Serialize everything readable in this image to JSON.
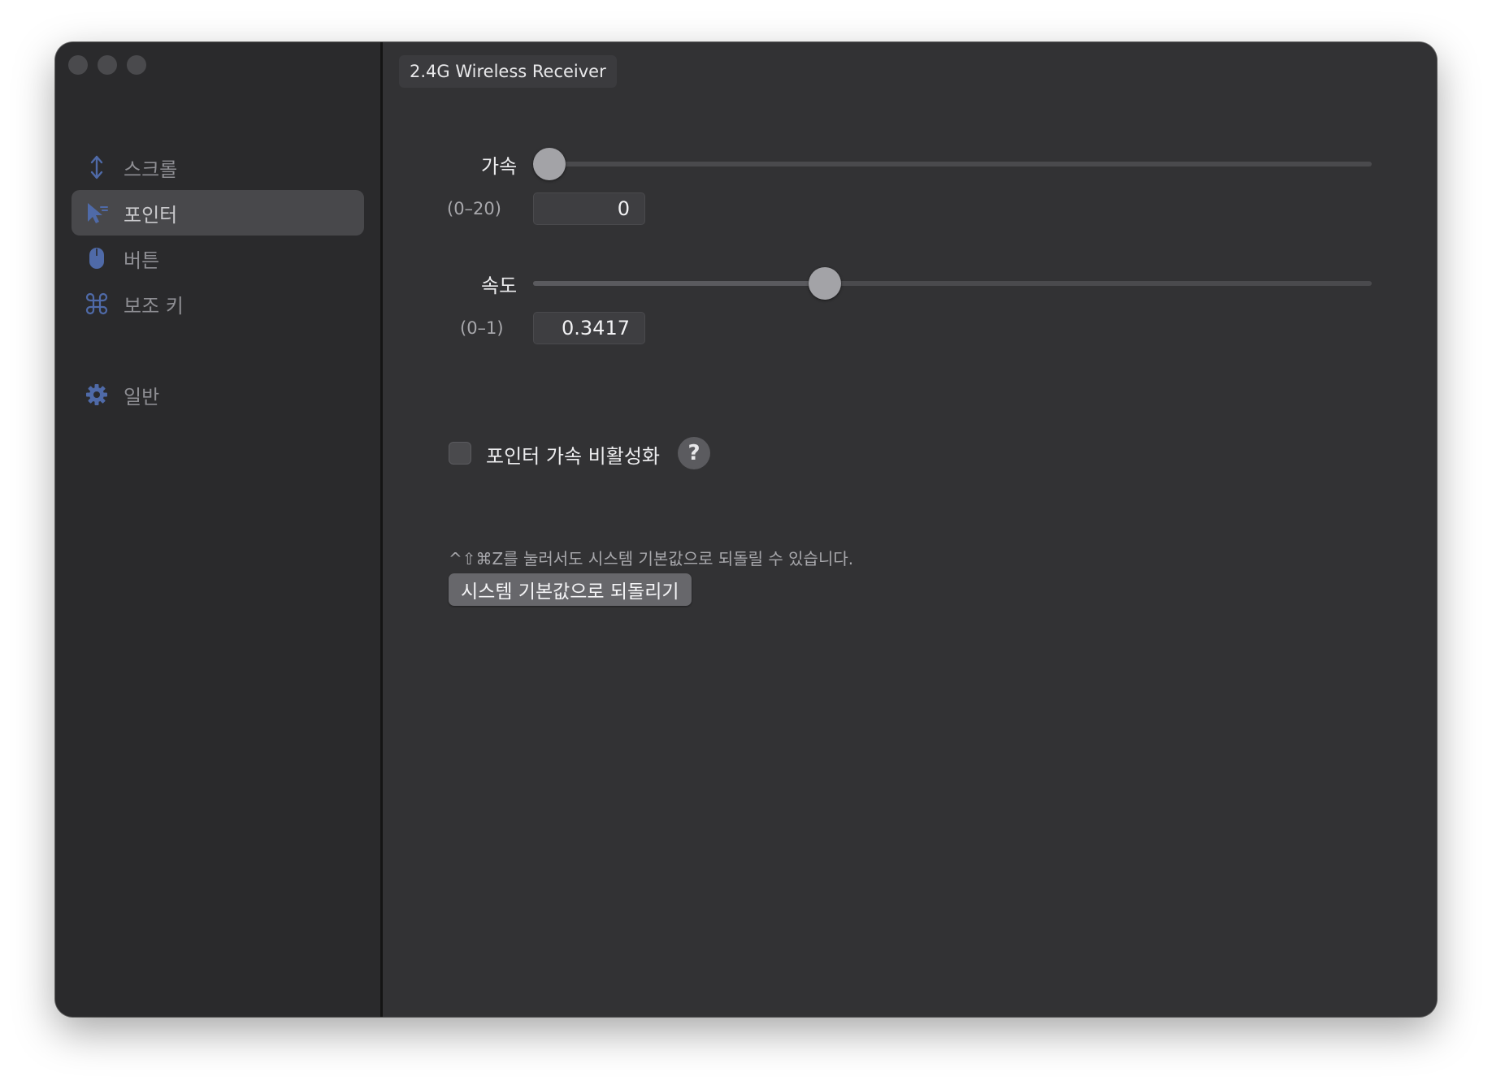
{
  "window": {
    "traffic_lights": [
      "close",
      "minimize",
      "zoom"
    ]
  },
  "sidebar": {
    "items": [
      {
        "label": "스크롤",
        "icon": "scroll-arrows-icon",
        "selected": false
      },
      {
        "label": "포인터",
        "icon": "pointer-cursor-icon",
        "selected": true
      },
      {
        "label": "버튼",
        "icon": "mouse-icon",
        "selected": false
      },
      {
        "label": "보조 키",
        "icon": "command-key-icon",
        "selected": false
      },
      {
        "label": "일반",
        "icon": "gear-icon",
        "selected": false
      }
    ],
    "icon_color": "#4f6aa8"
  },
  "device_tab": {
    "label": "2.4G Wireless Receiver"
  },
  "acceleration": {
    "label": "가속",
    "range_label": "(0–20)",
    "value": "0",
    "min": 0,
    "max": 20,
    "slider_value": 0
  },
  "speed": {
    "label": "속도",
    "range_label": "(0–1)",
    "value": "0.3417",
    "min": 0,
    "max": 1,
    "slider_value": 0.3417
  },
  "disable_acceleration": {
    "label": "포인터 가속 비활성화",
    "checked": false,
    "help_label": "?"
  },
  "reset": {
    "hint": "^⇧⌘Z를 눌러서도 시스템 기본값으로 되돌릴 수 있습니다.",
    "button_label": "시스템 기본값으로 되돌리기"
  }
}
